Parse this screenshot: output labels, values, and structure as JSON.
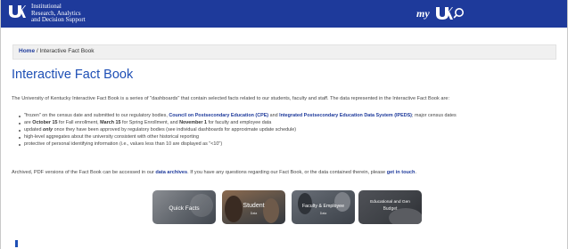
{
  "header": {
    "unit_lines": [
      "Institutional",
      "Research, Analytics",
      "and Decision Support"
    ],
    "myuk_label": "my",
    "colors": {
      "brand_blue": "#1e3a9b",
      "link_blue": "#1e4fb5"
    }
  },
  "breadcrumb": {
    "home": "Home",
    "separator": " / ",
    "current": "Interactive Fact Book"
  },
  "page": {
    "title": "Interactive Fact Book",
    "intro": "The University of Kentucky Interactive Fact Book is a series of \"dashboards\" that contain selected facts related to our students, faculty and staff. The data represented in the Interactive Fact Book are:",
    "bullets": [
      {
        "p1": "\"frozen\" on the census date and submitted to our regulatory bodies, ",
        "link1": "Council on Postsecondary Education (CPE)",
        "p2": " and ",
        "link2": "Integrated Postsecondary Education Data System (IPEDS)",
        "p3": "; major census dates"
      },
      {
        "p1": "are ",
        "b1": "October 15",
        "p2": " for Fall enrollment, ",
        "b2": "March 15",
        "p3": " for Spring Enrollment, and ",
        "b3": "November 1",
        "p4": " for faculty and employee data"
      },
      {
        "p1": "updated ",
        "b1": "only",
        "p2": " once they have been approved by regulatory bodies (see individual dashboards for approximate update schedule)"
      },
      {
        "text": "high-level aggregates about the university consistent with other historical reporting"
      },
      {
        "text": "protective of personal identifying information (i.e., values less than 10 are displayed as \"<10\")"
      }
    ],
    "archived": {
      "p1": "Archived, PDF versions of the Fact Book can be accessed in our ",
      "link1": "data archives",
      "p2": ". If you have any questions regarding our Fact Book, or the data contained therein, please ",
      "link2": "get in touch",
      "p3": "."
    }
  },
  "tiles": [
    {
      "title": "Quick Facts",
      "subtitle": ""
    },
    {
      "title": "Student",
      "subtitle": "Data"
    },
    {
      "title": "Faculty & Employee",
      "subtitle": "Data"
    },
    {
      "title": "Educational and Gen",
      "subtitle": "Budget"
    }
  ]
}
